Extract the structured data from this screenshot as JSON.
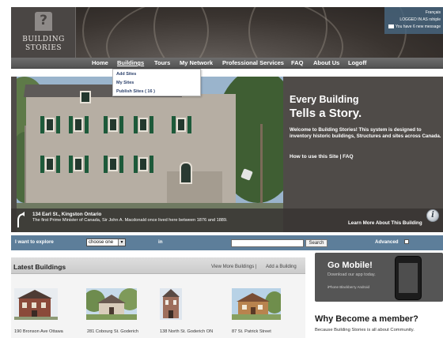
{
  "header": {
    "logo_line1": "BUILDING",
    "logo_line2": "STORIES",
    "language_link": "Français",
    "logged_in_text": "LOGGED IN AS rshiple",
    "messages_text": "You have 6 new message"
  },
  "nav": {
    "items": [
      "Home",
      "Buildings",
      "Tours",
      "My Network",
      "Professional Services",
      "FAQ",
      "About Us",
      "Logoff"
    ],
    "active": "Buildings"
  },
  "dropdown": {
    "items": [
      "Add Sites",
      "My Sites",
      "Publish Sites ( 16 )"
    ]
  },
  "hero": {
    "title_line1": "Every Building",
    "title_line2": "Tells a Story.",
    "text": "Welcome to Building Stories! This system is designed to inventory historic buildings, Structures and sites across Canada.",
    "howto_link": "How to use this Site | FAQ",
    "caption_address": "134 Earl St., Kingston Ontario",
    "caption_description": "The first Prime Minister of Canada, Sir John A. Macdonald once lived here between 1876 and 1889.",
    "learn_more": "Learn More About This Building",
    "info_icon_glyph": "i"
  },
  "explore": {
    "label": "I want to explore",
    "select_value": "choose one",
    "in_label": "in",
    "search_value": "",
    "search_button": "Search",
    "advanced_label": "Advanced"
  },
  "latest": {
    "title": "Latest Buildings",
    "view_more": "View More Buildings |",
    "add_building": "Add a Building",
    "buildings": [
      {
        "caption": "190 Bronson Ave Ottawa"
      },
      {
        "caption": "281 Cobourg St. Goderich"
      },
      {
        "caption": "138 North St. Goderich ON"
      },
      {
        "caption": "87 St. Patrick Street"
      }
    ]
  },
  "mobile": {
    "title": "Go Mobile!",
    "subtitle": "Download our app today.",
    "platforms": "iPhone   Blackberry   Android"
  },
  "membership": {
    "title": "Why Become a member?",
    "text": "Because Building Stories is all about Community."
  },
  "colors": {
    "nav_bg": "#5e5e5e",
    "hero_bg": "#4f4b48",
    "explore_bg": "#5d7e9a",
    "link_blue": "#2a3f6a"
  }
}
